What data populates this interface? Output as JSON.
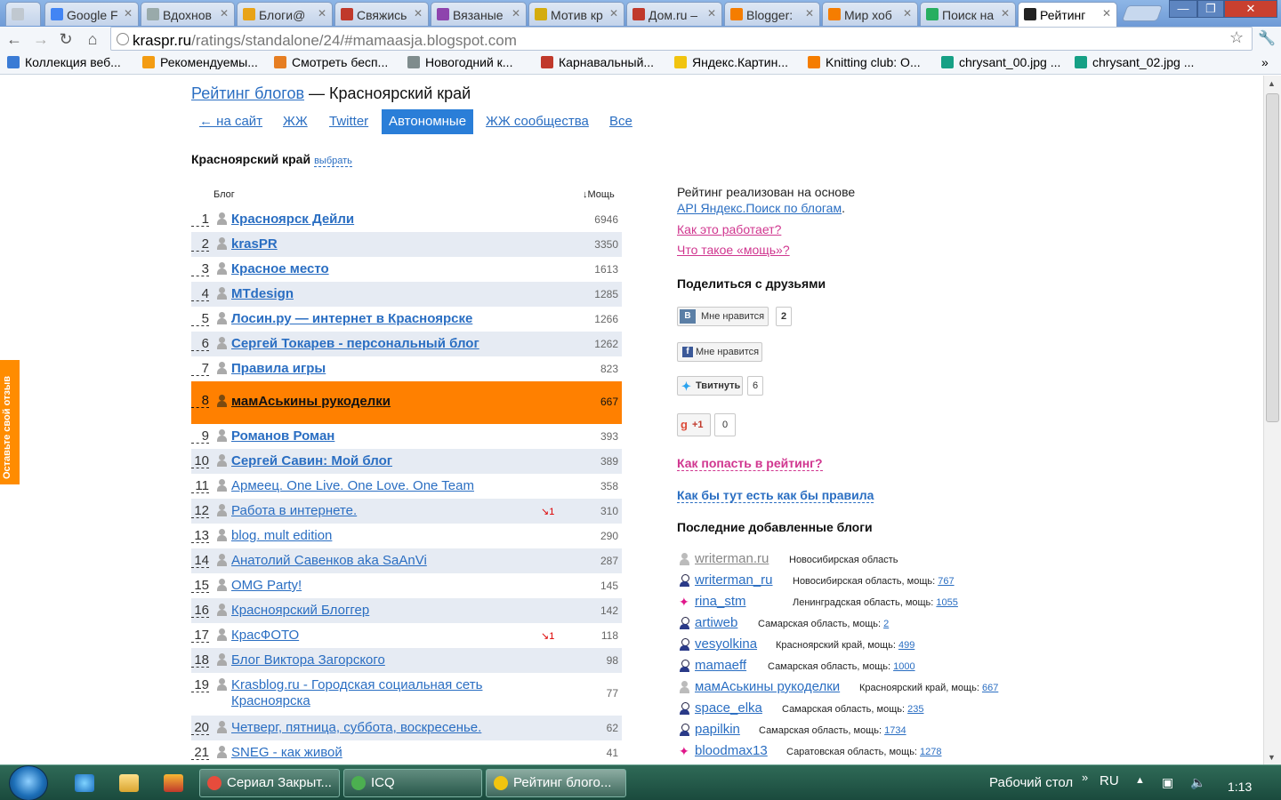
{
  "browser": {
    "tabs": [
      {
        "title": "",
        "fav": "#c0c8d0"
      },
      {
        "title": "Google F",
        "fav": "#4285f4"
      },
      {
        "title": "Вдохнов",
        "fav": "#9aa"
      },
      {
        "title": "Блоги@",
        "fav": "#e8a317"
      },
      {
        "title": "Свяжись",
        "fav": "#c0392b"
      },
      {
        "title": "Вязаные",
        "fav": "#8e44ad"
      },
      {
        "title": "Мотив кр",
        "fav": "#d4ac0d"
      },
      {
        "title": "Дом.ru –",
        "fav": "#c0392b"
      },
      {
        "title": "Blogger:",
        "fav": "#f57d00"
      },
      {
        "title": "Мир хоб",
        "fav": "#f57d00"
      },
      {
        "title": "Поиск на",
        "fav": "#27ae60"
      },
      {
        "title": "Рейтинг",
        "fav": "#222"
      }
    ],
    "url_host": "kraspr.ru",
    "url_path": "/ratings/standalone/24/#mamaasja.blogspot.com",
    "bookmarks": [
      {
        "label": "Коллекция веб...",
        "color": "#3a7bd5"
      },
      {
        "label": "Рекомендуемы...",
        "color": "#f39c12"
      },
      {
        "label": "Смотреть бесп...",
        "color": "#e67e22"
      },
      {
        "label": "Новогодний к...",
        "color": "#7f8c8d"
      },
      {
        "label": "Карнавальный...",
        "color": "#c0392b"
      },
      {
        "label": "Яндекс.Картин...",
        "color": "#f1c40f"
      },
      {
        "label": "Knitting club: O...",
        "color": "#f57d00"
      },
      {
        "label": "chrysant_00.jpg ...",
        "color": "#16a085"
      },
      {
        "label": "chrysant_02.jpg ...",
        "color": "#16a085"
      }
    ],
    "more": "»"
  },
  "page": {
    "title_link": "Рейтинг блогов",
    "title_rest": " — Красноярский край",
    "nav": [
      {
        "label": "← на сайт",
        "selected": false
      },
      {
        "label": "ЖЖ",
        "selected": false
      },
      {
        "label": "Twitter",
        "selected": false
      },
      {
        "label": "Автономные",
        "selected": true
      },
      {
        "label": "ЖЖ сообщества",
        "selected": false
      },
      {
        "label": "Все",
        "selected": false
      }
    ],
    "region": "Красноярский край",
    "region_pick": "выбрать",
    "col_blog": "Блог",
    "col_power": "↓Мощь",
    "feedback": "Оставьте свой отзыв",
    "rows": [
      {
        "n": "1",
        "name": "Красноярск Дейли",
        "power": "6946",
        "bold": true
      },
      {
        "n": "2",
        "name": "krasPR",
        "power": "3350",
        "bold": true
      },
      {
        "n": "3",
        "name": "Красное место",
        "power": "1613",
        "bold": true
      },
      {
        "n": "4",
        "name": "MTdesign",
        "power": "1285",
        "bold": true
      },
      {
        "n": "5",
        "name": "Лосин.ру — интернет в Красноярске",
        "power": "1266",
        "bold": true
      },
      {
        "n": "6",
        "name": "Сергей Токарев - персональный блог",
        "power": "1262",
        "bold": true
      },
      {
        "n": "7",
        "name": "Правила игры",
        "power": "823",
        "bold": true
      },
      {
        "n": "8",
        "name": "мамАськины рукоделки",
        "power": "667",
        "bold": true,
        "highlight": true
      },
      {
        "n": "9",
        "name": "Романов Роман",
        "power": "393",
        "bold": true
      },
      {
        "n": "10",
        "name": "Сергей Савин: Мой блог",
        "power": "389",
        "bold": true
      },
      {
        "n": "11",
        "name": "Армеец. One Live. One Love. One Team",
        "power": "358"
      },
      {
        "n": "12",
        "name": "Работа в интернете.",
        "power": "310",
        "change": "↘1"
      },
      {
        "n": "13",
        "name": "blog. mult edition",
        "power": "290"
      },
      {
        "n": "14",
        "name": "Анатолий Савенков aka SaAnVi",
        "power": "287"
      },
      {
        "n": "15",
        "name": "OMG Party!",
        "power": "145"
      },
      {
        "n": "16",
        "name": "Красноярский Блоггер",
        "power": "142"
      },
      {
        "n": "17",
        "name": "КрасФОТО",
        "power": "118",
        "change": "↘1"
      },
      {
        "n": "18",
        "name": "Блог Виктора Загорского",
        "power": "98"
      },
      {
        "n": "19",
        "name": "Krasblog.ru - Городская социальная сеть Красноярска",
        "power": "77",
        "tall": true
      },
      {
        "n": "20",
        "name": "Четверг, пятница, суббота, воскресенье.",
        "power": "62"
      },
      {
        "n": "21",
        "name": "SNEG - как живой",
        "power": "41"
      }
    ]
  },
  "sidebar": {
    "basis_text": "Рейтинг реализован на основе",
    "api_link": "API Яндекс.Поиск по блогам",
    "how_link": "Как это работает?",
    "power_link": "Что такое «мощь»?",
    "share_title": "Поделиться с друзьями",
    "vk_label": "Мне нравится",
    "vk_count": "2",
    "fb_label": "Мне нравится",
    "tw_label": "Твитнуть",
    "tw_count": "6",
    "gp_label": "+1",
    "gp_count": "0",
    "join_link": "Как попасть в рейтинг?",
    "rules_link": "Как бы тут есть как бы правила",
    "recent_title": "Последние добавленные блоги",
    "recent": [
      {
        "name": "writerman.ru",
        "icon": "grey",
        "region": "Новосибирская область",
        "power": ""
      },
      {
        "name": "writerman_ru",
        "icon": "user",
        "region": "Новосибирская область, мощь: ",
        "power": "767"
      },
      {
        "name": "rina_stm",
        "icon": "twitter",
        "region": "Ленинградская область, мощь: ",
        "power": "1055"
      },
      {
        "name": "artiweb",
        "icon": "user",
        "region": "Самарская область, мощь: ",
        "power": "2"
      },
      {
        "name": "vesyolkina",
        "icon": "user",
        "region": "Красноярский край, мощь: ",
        "power": "499"
      },
      {
        "name": "mamaeff",
        "icon": "user",
        "region": "Самарская область, мощь: ",
        "power": "1000"
      },
      {
        "name": "мамАськины рукоделки",
        "icon": "grey",
        "region": "Красноярский край, мощь: ",
        "power": "667"
      },
      {
        "name": "space_elka",
        "icon": "user",
        "region": "Самарская область, мощь: ",
        "power": "235"
      },
      {
        "name": "papilkin",
        "icon": "user",
        "region": "Самарская область, мощь: ",
        "power": "1734"
      },
      {
        "name": "bloodmax13",
        "icon": "twitter",
        "region": "Саратовская область, мощь: ",
        "power": "1278"
      }
    ]
  },
  "taskbar": {
    "buttons": [
      {
        "label": "Сериал Закрыт...",
        "color": "#e74c3c"
      },
      {
        "label": "ICQ",
        "color": "#4caf50"
      },
      {
        "label": "Рейтинг блого...",
        "color": "#f1c40f",
        "active": true
      }
    ],
    "desktop": "Рабочий стол",
    "lang": "RU",
    "time": "1:13"
  }
}
